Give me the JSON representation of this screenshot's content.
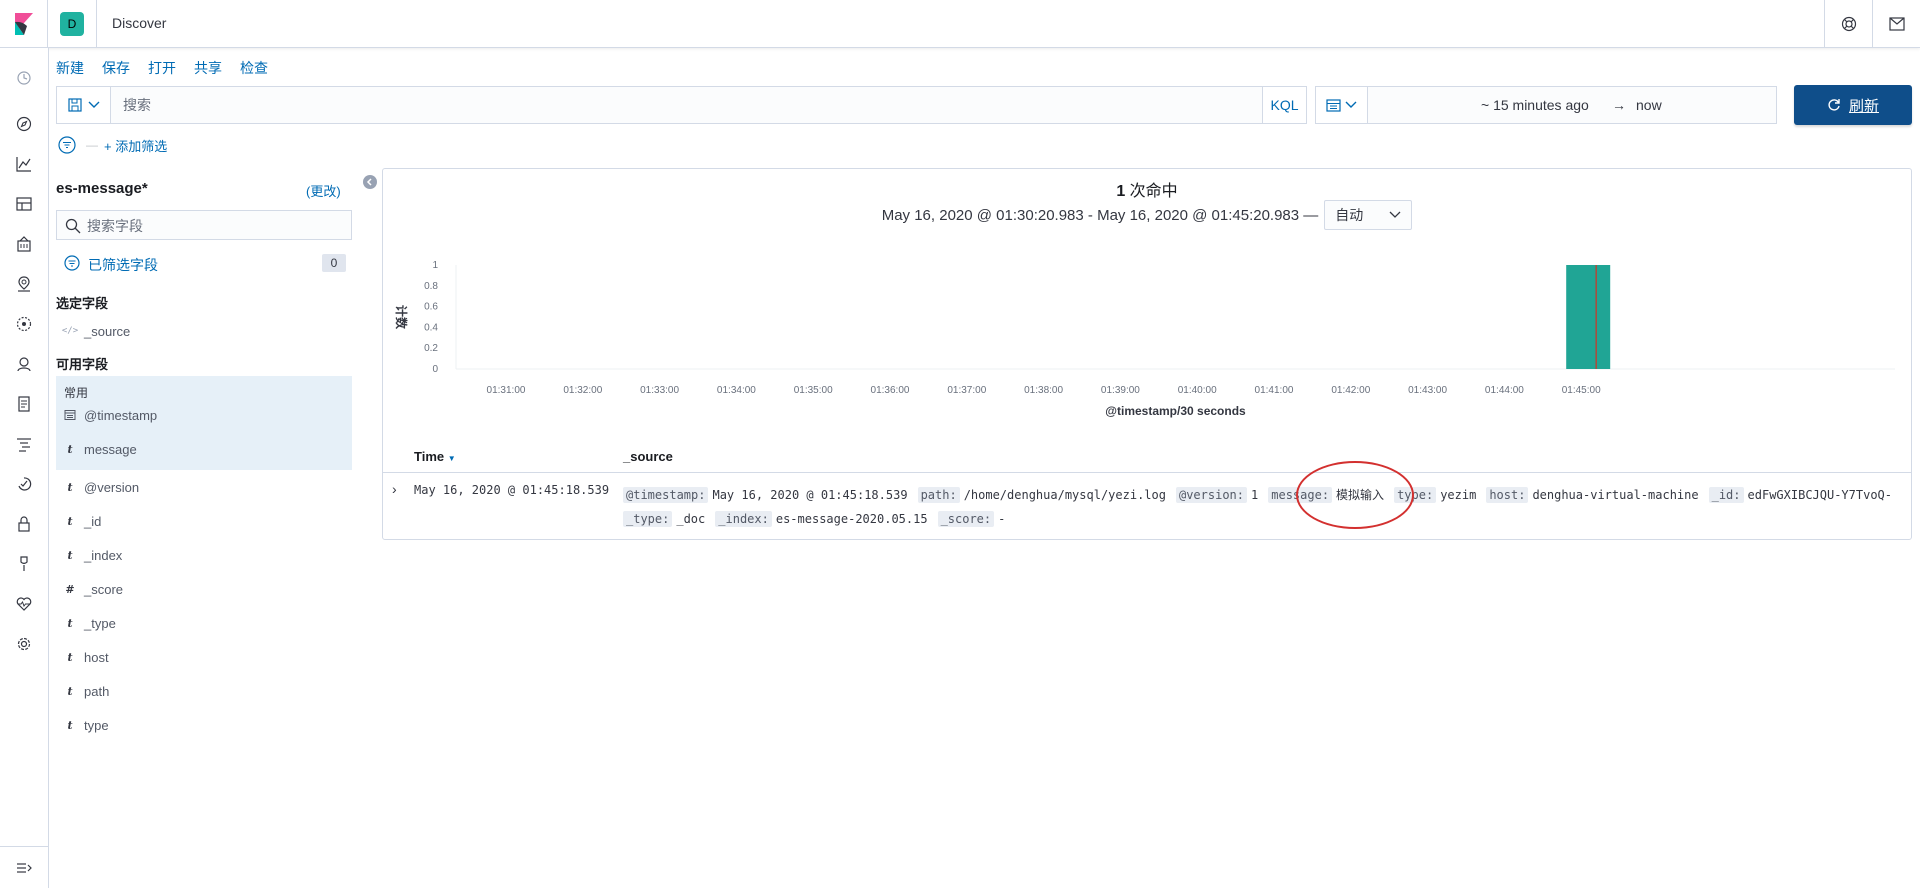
{
  "header": {
    "space_initial": "D",
    "breadcrumb": "Discover"
  },
  "top_menu": {
    "new_label": "新建",
    "save_label": "保存",
    "open_label": "打开",
    "share_label": "共享",
    "inspect_label": "检查"
  },
  "query": {
    "placeholder": "搜索",
    "language_label": "KQL"
  },
  "date_picker": {
    "start": "~ 15 minutes ago",
    "arrow": "→",
    "end": "now"
  },
  "refresh": {
    "label": "刷新"
  },
  "filter_bar": {
    "dash": "—",
    "add_filter_label": "+ 添加筛选"
  },
  "sidebar": {
    "index_pattern": "es-message*",
    "change_label": "(更改)",
    "field_search_placeholder": "搜索字段",
    "filtered_fields_label": "已筛选字段",
    "filtered_fields_count": "0",
    "selected_fields_title": "选定字段",
    "selected_fields": [
      {
        "type": "</>",
        "name": "_source"
      }
    ],
    "available_fields_title": "可用字段",
    "popular_title": "常用",
    "popular_fields": [
      {
        "type": "date",
        "name": "@timestamp"
      },
      {
        "type": "t",
        "name": "message"
      }
    ],
    "available_fields": [
      {
        "type": "t",
        "name": "@version"
      },
      {
        "type": "t",
        "name": "_id"
      },
      {
        "type": "t",
        "name": "_index"
      },
      {
        "type": "#",
        "name": "_score"
      },
      {
        "type": "t",
        "name": "_type"
      },
      {
        "type": "t",
        "name": "host"
      },
      {
        "type": "t",
        "name": "path"
      },
      {
        "type": "t",
        "name": "type"
      }
    ]
  },
  "results": {
    "hits": "1",
    "hits_suffix": "次命中",
    "time_range": "May 16, 2020 @ 01:30:20.983 - May 16, 2020 @ 01:45:20.983 —",
    "interval_label": "自动"
  },
  "chart_data": {
    "type": "bar",
    "xlabel": "@timestamp/30 seconds",
    "ylabel": "计数",
    "ylim": [
      0,
      1
    ],
    "y_ticks": [
      "0",
      "0.2",
      "0.4",
      "0.6",
      "0.8",
      "1"
    ],
    "x_ticks": [
      "01:31:00",
      "01:32:00",
      "01:33:00",
      "01:34:00",
      "01:35:00",
      "01:36:00",
      "01:37:00",
      "01:38:00",
      "01:39:00",
      "01:40:00",
      "01:41:00",
      "01:42:00",
      "01:43:00",
      "01:44:00",
      "01:45:00"
    ],
    "bars": [
      {
        "x": "01:45:00",
        "value": 1
      }
    ],
    "bar_color": "#20a595"
  },
  "table": {
    "time_header": "Time",
    "source_header": "_source",
    "rows": [
      {
        "time": "May 16, 2020 @ 01:45:18.539",
        "fields": [
          {
            "key": "@timestamp:",
            "value": "May 16, 2020 @ 01:45:18.539"
          },
          {
            "key": "path:",
            "value": "/home/denghua/mysql/yezi.log"
          },
          {
            "key": "@version:",
            "value": "1"
          },
          {
            "key": "message:",
            "value": "模拟输入"
          },
          {
            "key": "type:",
            "value": "yezim"
          },
          {
            "key": "host:",
            "value": "denghua-virtual-machine"
          },
          {
            "key": "_id:",
            "value": "edFwGXIBCJQU-Y7TvoQ-"
          },
          {
            "key": "_type:",
            "value": "_doc"
          },
          {
            "key": "_index:",
            "value": "es-message-2020.05.15"
          },
          {
            "key": "_score:",
            "value": "-"
          }
        ]
      }
    ]
  },
  "colors": {
    "link": "#006bb4",
    "primary_button": "#0f4e8a",
    "annotation": "#d3302f"
  }
}
